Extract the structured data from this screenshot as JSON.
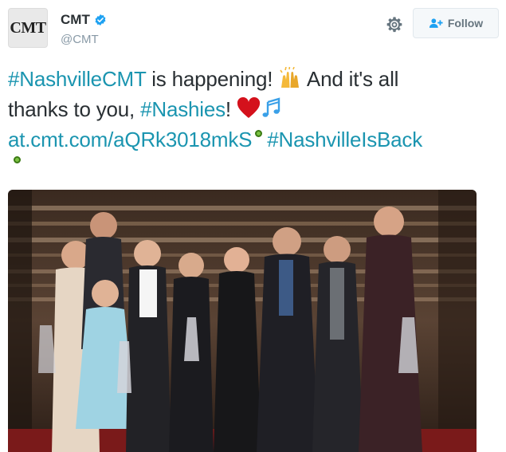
{
  "account": {
    "avatar_text": "CMT",
    "display_name": "CMT",
    "handle": "@CMT"
  },
  "actions": {
    "follow_label": "Follow"
  },
  "tweet": {
    "hashtag_1": "#NashvilleCMT",
    "text_1": " is happening! ",
    "text_2": " And it's all",
    "text_3": "thanks to you, ",
    "hashtag_2": "#Nashies",
    "text_4": "! ",
    "link": "at.cmt.com/aQRk3018mkS",
    "hashtag_3": "#NashvilleIsBack"
  },
  "colors": {
    "link": "#1b95b0",
    "verified": "#1da1f2",
    "text": "#292f33"
  },
  "icons": [
    "verified-badge-icon",
    "gear-icon",
    "follow-user-plus-icon",
    "raised-hands-emoji",
    "red-heart-emoji",
    "music-notes-emoji"
  ]
}
